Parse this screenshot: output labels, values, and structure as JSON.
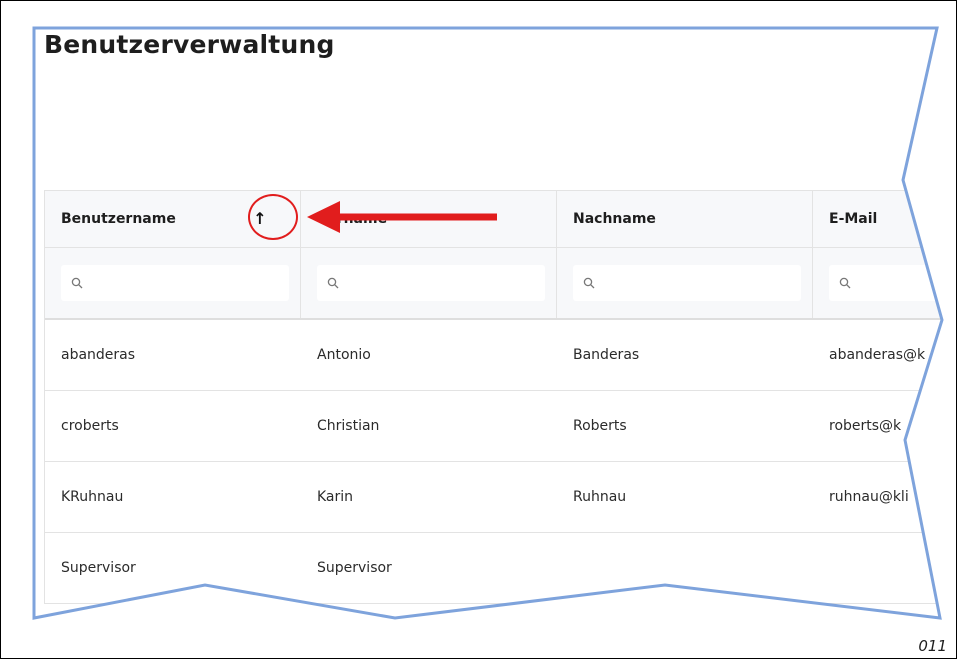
{
  "page": {
    "title": "Benutzerverwaltung",
    "page_number": "011"
  },
  "table": {
    "headers": {
      "username": "Benutzername",
      "firstname": "Vorname",
      "lastname": "Nachname",
      "email": "E-Mail"
    },
    "rows": [
      {
        "username": "abanderas",
        "firstname": "Antonio",
        "lastname": "Banderas",
        "email": "abanderas@k"
      },
      {
        "username": "croberts",
        "firstname": "Christian",
        "lastname": "Roberts",
        "email": "roberts@k"
      },
      {
        "username": "KRuhnau",
        "firstname": "Karin",
        "lastname": "Ruhnau",
        "email": "ruhnau@kli"
      },
      {
        "username": "Supervisor",
        "firstname": "Supervisor",
        "lastname": "",
        "email": ""
      }
    ],
    "sort_icon": "arrow-up-icon"
  },
  "annotation": {
    "color": "#e11d1d",
    "arrow_icon": "arrow-left-icon"
  },
  "colors": {
    "header_bg": "#f7f8fa",
    "frame_outline": "#7ea3dc"
  }
}
